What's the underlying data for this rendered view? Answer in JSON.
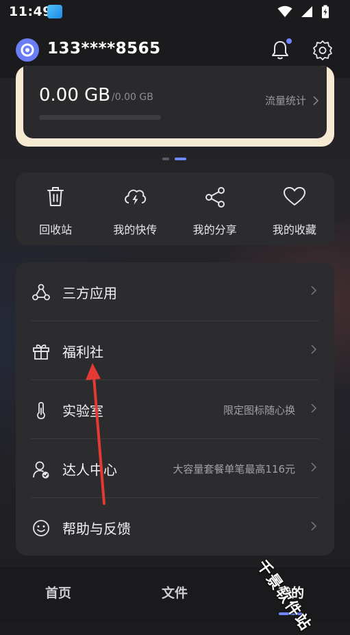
{
  "status_bar": {
    "time": "11:49"
  },
  "header": {
    "phone": "133****8565"
  },
  "storage": {
    "used": "0.00 GB",
    "total": "/0.00 GB",
    "stats_link": "流量统计",
    "progress_fraction": 0
  },
  "carousel": {
    "page_count": 2,
    "active_index": 1
  },
  "quick_actions": [
    {
      "label": "回收站",
      "icon": "trash-icon"
    },
    {
      "label": "我的快传",
      "icon": "cloud-lightning-icon"
    },
    {
      "label": "我的分享",
      "icon": "share-icon"
    },
    {
      "label": "我的收藏",
      "icon": "heart-icon"
    }
  ],
  "menu": [
    {
      "title": "三方应用",
      "subtitle": "",
      "icon": "apps-network-icon"
    },
    {
      "title": "福利社",
      "subtitle": "",
      "icon": "gift-icon"
    },
    {
      "title": "实验室",
      "subtitle": "限定图标随心换",
      "icon": "thermometer-icon"
    },
    {
      "title": "达人中心",
      "subtitle": "大容量套餐单笔最高116元",
      "icon": "user-verified-icon"
    },
    {
      "title": "帮助与反馈",
      "subtitle": "",
      "icon": "smiley-icon"
    }
  ],
  "tabs": [
    {
      "label": "首页",
      "active": false
    },
    {
      "label": "文件",
      "active": false
    },
    {
      "label": "我的",
      "active": true
    }
  ],
  "watermark": "千景软件站",
  "colors": {
    "accent": "#6f86ff",
    "card": "#2c2c2f",
    "card_border": "#f6ead3",
    "annotation_arrow": "#e53935"
  }
}
